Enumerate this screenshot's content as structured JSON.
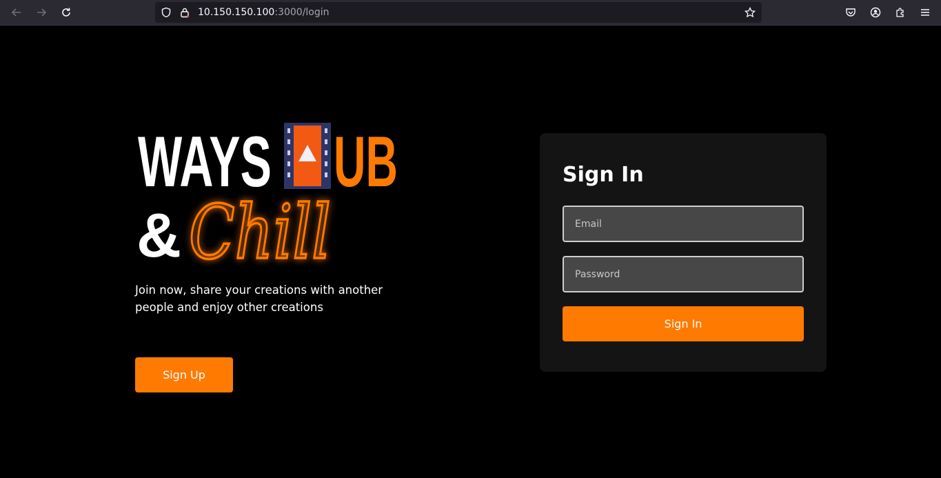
{
  "browser": {
    "url_host": "10.150.150.100",
    "url_path": ":3000/login",
    "icons": [
      "back-arrow-icon",
      "forward-arrow-icon",
      "reload-icon",
      "shield-icon",
      "lock-icon",
      "bookmark-star-icon",
      "pocket-icon",
      "account-icon",
      "extensions-icon",
      "menu-icon"
    ]
  },
  "brand": {
    "logo_word_1": "WAYS",
    "logo_word_2": "UB",
    "logo_word_3": "&",
    "logo_script": "Chill",
    "logo_icon": "film-play-icon",
    "accent_color": "#ff7a00"
  },
  "hero": {
    "tagline": "Join now, share your creations with another people and enjoy other creations",
    "signup_label": "Sign Up"
  },
  "login": {
    "title": "Sign In",
    "email_placeholder": "Email",
    "password_placeholder": "Password",
    "submit_label": "Sign In"
  }
}
